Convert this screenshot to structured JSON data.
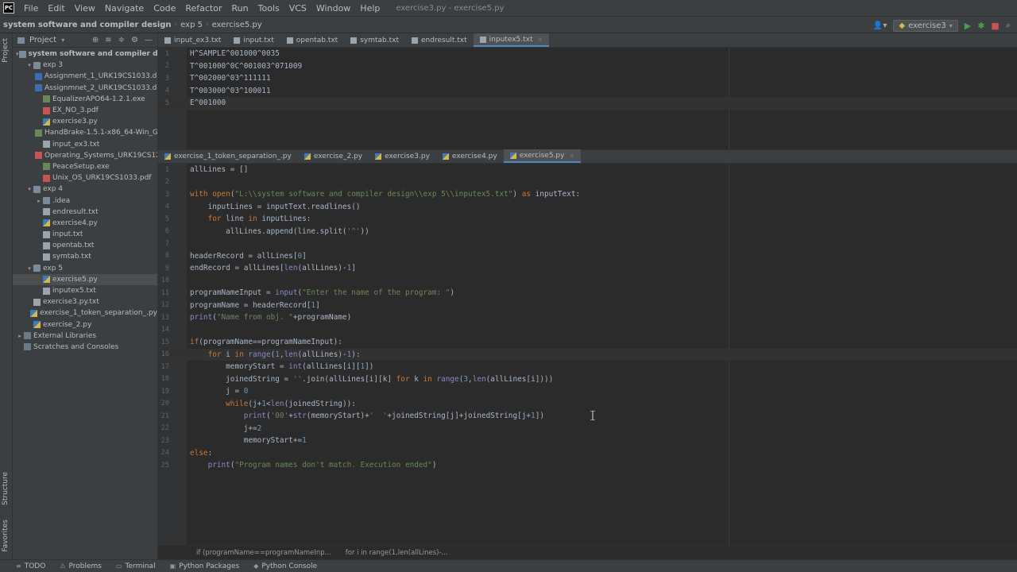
{
  "menu": {
    "logo": "PC",
    "items": [
      "File",
      "Edit",
      "View",
      "Navigate",
      "Code",
      "Refactor",
      "Run",
      "Tools",
      "VCS",
      "Window",
      "Help"
    ],
    "window_title": "exercise3.py - exercise5.py"
  },
  "breadcrumb": {
    "project": "system software and compiler design",
    "folder": "exp 5",
    "file": "exercise5.py"
  },
  "run_config": {
    "name": "exercise3",
    "run_icon": "run-icon",
    "debug_icon": "debug-icon"
  },
  "project_panel": {
    "title": "Project",
    "tree": [
      {
        "label": "system software and compiler design",
        "indent": 1,
        "arrow": "▾",
        "icon": "folder",
        "bold": true
      },
      {
        "label": "exp 3",
        "indent": 2,
        "arrow": "▾",
        "icon": "folder"
      },
      {
        "label": "Assignment_1_URK19CS1033.docx",
        "indent": 3,
        "arrow": "",
        "icon": "docx"
      },
      {
        "label": "Assignmnet_2_URK19CS1033.docx",
        "indent": 3,
        "arrow": "",
        "icon": "docx"
      },
      {
        "label": "EqualizerAPO64-1.2.1.exe",
        "indent": 3,
        "arrow": "",
        "icon": "exe"
      },
      {
        "label": "EX_NO_3.pdf",
        "indent": 3,
        "arrow": "",
        "icon": "pdf"
      },
      {
        "label": "exercise3.py",
        "indent": 3,
        "arrow": "",
        "icon": "py"
      },
      {
        "label": "HandBrake-1.5.1-x86_64-Win_GUI.",
        "indent": 3,
        "arrow": "",
        "icon": "exe"
      },
      {
        "label": "input_ex3.txt",
        "indent": 3,
        "arrow": "",
        "icon": "txt"
      },
      {
        "label": "Operating_Systems_URK19CS1213.",
        "indent": 3,
        "arrow": "",
        "icon": "pdf"
      },
      {
        "label": "PeaceSetup.exe",
        "indent": 3,
        "arrow": "",
        "icon": "exe"
      },
      {
        "label": "Unix_OS_URK19CS1033.pdf",
        "indent": 3,
        "arrow": "",
        "icon": "pdf"
      },
      {
        "label": "exp 4",
        "indent": 2,
        "arrow": "▾",
        "icon": "folder"
      },
      {
        "label": ".idea",
        "indent": 3,
        "arrow": "▸",
        "icon": "folder"
      },
      {
        "label": "endresult.txt",
        "indent": 3,
        "arrow": "",
        "icon": "txt"
      },
      {
        "label": "exercise4.py",
        "indent": 3,
        "arrow": "",
        "icon": "py"
      },
      {
        "label": "input.txt",
        "indent": 3,
        "arrow": "",
        "icon": "txt"
      },
      {
        "label": "opentab.txt",
        "indent": 3,
        "arrow": "",
        "icon": "txt"
      },
      {
        "label": "symtab.txt",
        "indent": 3,
        "arrow": "",
        "icon": "txt"
      },
      {
        "label": "exp 5",
        "indent": 2,
        "arrow": "▾",
        "icon": "folder"
      },
      {
        "label": "exercise5.py",
        "indent": 3,
        "arrow": "",
        "icon": "py"
      },
      {
        "label": "inputex5.txt",
        "indent": 3,
        "arrow": "",
        "icon": "txt"
      },
      {
        "label": "exercise3.py.txt",
        "indent": 2,
        "arrow": "",
        "icon": "txt"
      },
      {
        "label": "exercise_1_token_separation_.py",
        "indent": 2,
        "arrow": "",
        "icon": "py"
      },
      {
        "label": "exercise_2.py",
        "indent": 2,
        "arrow": "",
        "icon": "py"
      },
      {
        "label": "External Libraries",
        "indent": 1,
        "arrow": "▸",
        "icon": "lib"
      },
      {
        "label": "Scratches and Consoles",
        "indent": 1,
        "arrow": "",
        "icon": "lib"
      }
    ]
  },
  "left_strip": {
    "project": "Project",
    "structure": "Structure",
    "favorites": "Favorites"
  },
  "top_tabs": [
    {
      "label": "input_ex3.txt",
      "active": false
    },
    {
      "label": "input.txt",
      "active": false
    },
    {
      "label": "opentab.txt",
      "active": false
    },
    {
      "label": "symtab.txt",
      "active": false
    },
    {
      "label": "endresult.txt",
      "active": false
    },
    {
      "label": "inputex5.txt",
      "active": true
    }
  ],
  "top_editor": {
    "lines": [
      "H^SAMPLE^001000^0035",
      "T^001000^0C^001003^071009",
      "T^002000^03^111111",
      "T^003000^03^100011",
      "E^001000"
    ],
    "current_line": 5
  },
  "bottom_tabs": [
    {
      "label": "exercise_1_token_separation_.py",
      "active": false
    },
    {
      "label": "exercise_2.py",
      "active": false
    },
    {
      "label": "exercise3.py",
      "active": false
    },
    {
      "label": "exercise4.py",
      "active": false
    },
    {
      "label": "exercise5.py",
      "active": true
    }
  ],
  "bottom_editor": {
    "current_line": 16,
    "lines": [
      "allLines = []",
      "",
      "with open(\"L:\\\\system software and compiler design\\\\exp 5\\\\inputex5.txt\") as inputText:",
      "    inputLines = inputText.readlines()",
      "    for line in inputLines:",
      "        allLines.append(line.split('^'))",
      "",
      "headerRecord = allLines[0]",
      "endRecord = allLines[len(allLines)-1]",
      "",
      "programNameInput = input(\"Enter the name of the program: \")",
      "programName = headerRecord[1]",
      "print(\"Name from obj. \"+programName)",
      "",
      "if(programName==programNameInput):",
      "    for i in range(1,len(allLines)-1):",
      "        memoryStart = int(allLines[i][1])",
      "        joinedString = ''.join(allLines[i][k] for k in range(3,len(allLines[i])))",
      "        j = 0",
      "        while(j+1<len(joinedString)):",
      "            print('00'+str(memoryStart)+'  '+joinedString[j]+joinedString[j+1])",
      "            j+=2",
      "            memoryStart+=1",
      "else:",
      "    print(\"Program names don't match. Execution ended\")"
    ]
  },
  "code_crumbs": [
    "if (programName==programNameInp...",
    "for i in range(1,len(allLines)-..."
  ],
  "status_bar": [
    {
      "label": "TODO",
      "icon": "list-icon"
    },
    {
      "label": "Problems",
      "icon": "warning-icon"
    },
    {
      "label": "Terminal",
      "icon": "terminal-icon"
    },
    {
      "label": "Python Packages",
      "icon": "package-icon"
    },
    {
      "label": "Python Console",
      "icon": "python-icon"
    }
  ],
  "colors": {
    "keyword": "#cc7832",
    "string": "#6a8759",
    "number": "#6897bb",
    "builtin": "#8888c6",
    "text": "#a9b7c6",
    "accent": "#4a88c7"
  }
}
